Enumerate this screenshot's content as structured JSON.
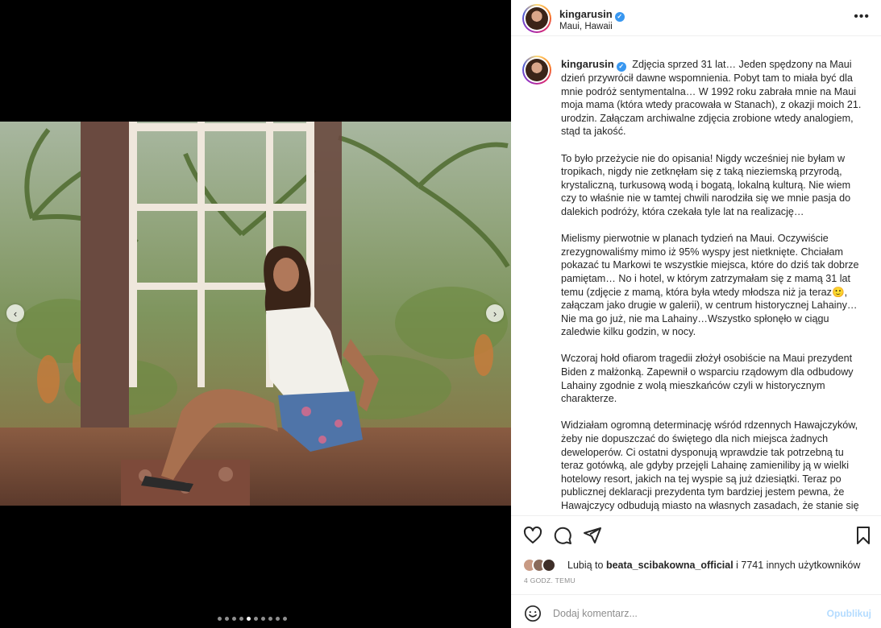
{
  "post": {
    "username": "kingarusin",
    "location": "Maui, Hawaii",
    "verified_icon": "verified-badge-icon",
    "caption_paragraphs": [
      "Zdjęcia sprzed 31 lat… Jeden spędzony na Maui dzień przywrócił dawne wspomnienia. Pobyt tam to miała być dla mnie podróż sentymentalna… W 1992 roku zabrała mnie na Maui moja mama (która wtedy pracowała w Stanach), z okazji moich 21. urodzin. Załączam archiwalne zdjęcia zrobione wtedy analogiem, stąd ta jakość.",
      "To było przeżycie nie do opisania! Nigdy wcześniej nie byłam w tropikach, nigdy nie zetknęłam się z taką nieziemską przyrodą, krystaliczną, turkusową wodą i bogatą, lokalną kulturą. Nie wiem czy to właśnie nie w tamtej chwili narodziła się we mnie pasja do dalekich podróży, która czekała tyle lat na realizację…",
      "Mielismy pierwotnie w planach tydzień na Maui. Oczywiście zrezygnowaliśmy mimo iż 95% wyspy jest nietknięte. Chciałam pokazać tu Markowi te wszystkie miejsca, które do dziś tak dobrze pamiętam… No i hotel, w którym zatrzymałam się z mamą 31 lat temu (zdjęcie z mamą, która była wtedy młodsza niż ja teraz🙂, załączam jako drugie w galerii), w centrum historycznej Lahainy… Nie ma go już, nie ma Lahainy…Wszystko spłonęło w ciągu zaledwie kilku godzin, w nocy.",
      "Wczoraj hołd ofiarom tragedii złożył osobiście na Maui prezydent Biden z małżonką. Zapewnił o wsparciu rządowym dla odbudowy Lahainy zgodnie z wolą mieszkańców czyli w historycznym charakterze.",
      "Widziałam ogromną determinację wśród rdzennych Hawajczyków, żeby nie dopuszczać do świętego dla nich miejsca żadnych deweloperów. Ci ostatni dysponują wprawdzie tak potrzebną tu teraz gotówką, ale gdyby przejęli Lahainę zamieniliby ją w wielki hotelowy resort, jakich na tej wyspie są już dziesiątki. Teraz po publicznej deklaracji prezydenta tym bardziej jestem pewna, że Hawajczycy odbudują miasto na własnych zasadach, że stanie się"
    ],
    "likes": {
      "prefix": "Lubią to",
      "user": "beata_scibakowna_official",
      "suffix": "i 7741 innych użytkowników"
    },
    "time": "4 GODZ. TEMU",
    "comment": {
      "placeholder": "Dodaj komentarz...",
      "publish_label": "Opublikuj"
    }
  },
  "carousel": {
    "total": 10,
    "active_index": 4
  },
  "icons": {
    "more": "more-options-icon",
    "like": "heart-icon",
    "comment": "comment-icon",
    "share": "share-icon",
    "save": "bookmark-icon",
    "emoji": "emoji-icon",
    "prev": "chevron-left-icon",
    "next": "chevron-right-icon"
  },
  "colors": {
    "publish_disabled": "#b3dbff",
    "verified": "#3897f0",
    "muted": "#8e8e8e"
  }
}
